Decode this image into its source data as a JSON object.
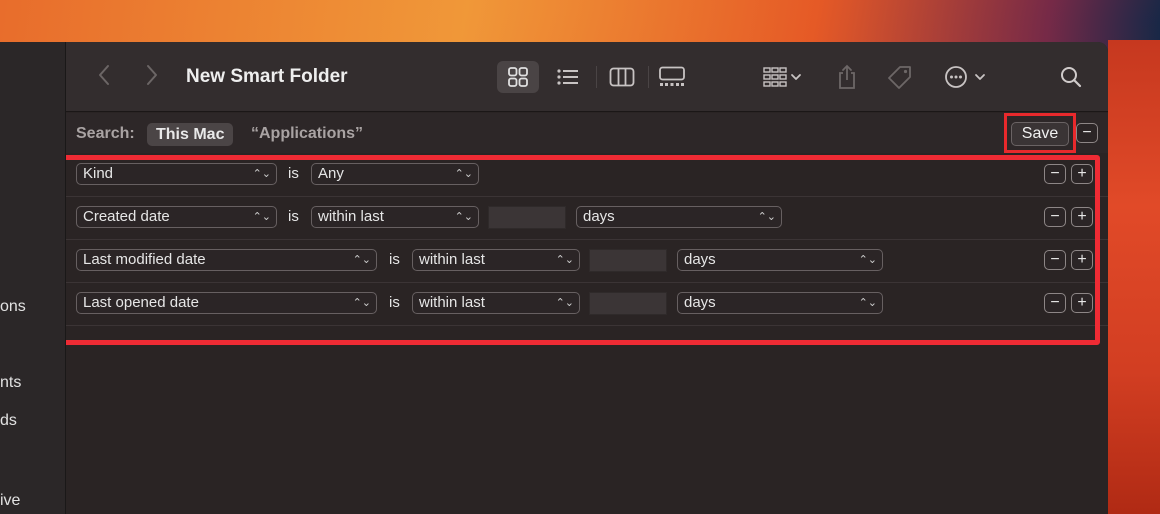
{
  "window": {
    "title": "New Smart Folder"
  },
  "sidebar": {
    "items": [
      {
        "label": "ons"
      },
      {
        "label": "nts"
      },
      {
        "label": "ds"
      },
      {
        "label": "ive"
      }
    ]
  },
  "toolbar": {
    "back_icon": "chevron-left-icon",
    "forward_icon": "chevron-right-icon",
    "view_icons": [
      "icon-view-grid-icon",
      "list-view-icon",
      "column-view-icon",
      "gallery-view-icon"
    ],
    "group_icon": "group-by-icon",
    "share_icon": "share-icon",
    "tag_icon": "tag-icon",
    "more_icon": "ellipsis-circle-icon",
    "search_icon": "search-icon"
  },
  "scope": {
    "label": "Search:",
    "selected": "This Mac",
    "other": "“Applications”",
    "save_label": "Save",
    "minus_label": "−"
  },
  "criteria": [
    {
      "attribute": "Kind",
      "operator": "is",
      "value": "Any"
    },
    {
      "attribute": "Created date",
      "operator": "is",
      "value": "within last",
      "number": "",
      "unit": "days"
    },
    {
      "attribute": "Last modified date",
      "operator": "is",
      "value": "within last",
      "number": "",
      "unit": "days"
    },
    {
      "attribute": "Last opened date",
      "operator": "is",
      "value": "within last",
      "number": "",
      "unit": "days"
    }
  ],
  "row_buttons": {
    "minus": "−",
    "plus": "+"
  },
  "colors": {
    "highlight": "#ee2b34",
    "window_bg": "#2a2424",
    "toolbar_bg": "#332d2e"
  }
}
